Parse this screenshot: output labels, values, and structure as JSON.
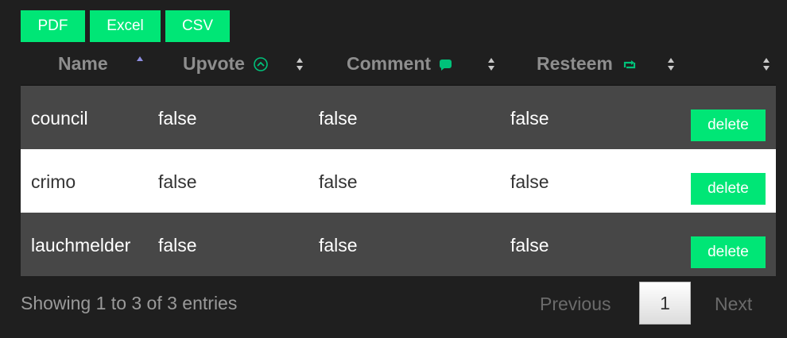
{
  "colors": {
    "accent": "#00e676",
    "dark_row": "#474747",
    "light_row": "#ffffff",
    "background": "#1f1f1f"
  },
  "toolbar": {
    "pdf_label": "PDF",
    "excel_label": "Excel",
    "csv_label": "CSV"
  },
  "table": {
    "headers": {
      "name": "Name",
      "upvote": "Upvote",
      "comment": "Comment",
      "resteem": "Resteem"
    },
    "header_icons": {
      "upvote": "upvote-circle-icon",
      "comment": "comment-bubble-icon",
      "resteem": "resteem-arrows-icon"
    },
    "sort": {
      "column": "Name",
      "direction": "asc"
    },
    "rows": [
      {
        "name": "council",
        "upvote": "false",
        "comment": "false",
        "resteem": "false",
        "action": "delete"
      },
      {
        "name": "crimo",
        "upvote": "false",
        "comment": "false",
        "resteem": "false",
        "action": "delete"
      },
      {
        "name": "lauchmelder",
        "upvote": "false",
        "comment": "false",
        "resteem": "false",
        "action": "delete"
      }
    ]
  },
  "footer": {
    "info": "Showing 1 to 3 of 3 entries",
    "previous": "Previous",
    "page": "1",
    "next": "Next"
  }
}
